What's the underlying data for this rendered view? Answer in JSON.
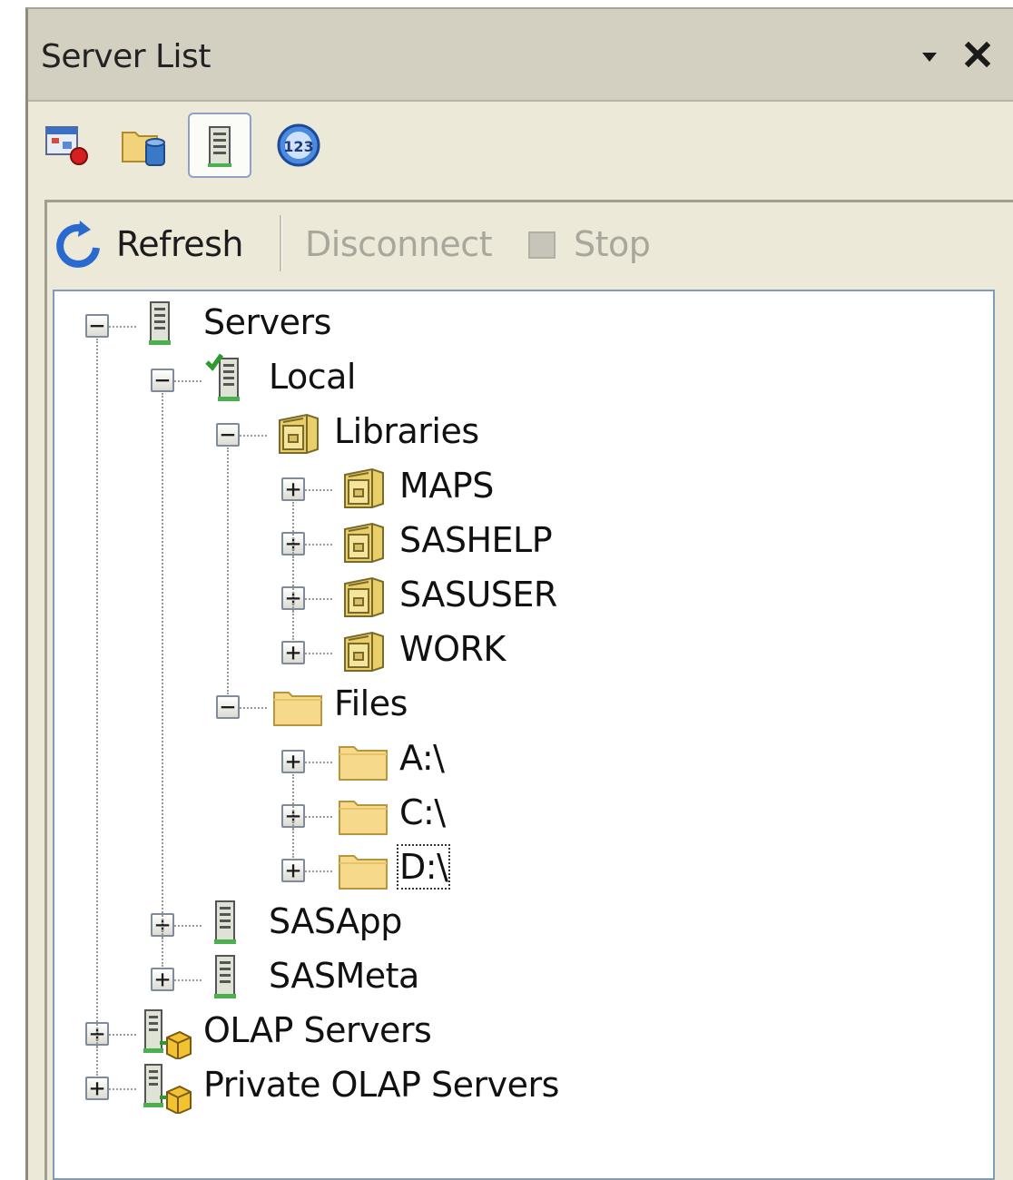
{
  "panel": {
    "title": "Server List",
    "pin_glyph": "▾",
    "close_glyph": "✕"
  },
  "view_toolbar": {
    "buttons": [
      {
        "icon": "process-flow-icon",
        "active": false
      },
      {
        "icon": "data-folder-icon",
        "active": false
      },
      {
        "icon": "server-icon",
        "active": true
      },
      {
        "icon": "task-status-icon",
        "active": false
      }
    ]
  },
  "command_bar": {
    "refresh_label": "Refresh",
    "disconnect_label": "Disconnect",
    "stop_label": "Stop",
    "disconnect_enabled": false,
    "stop_enabled": false
  },
  "tree": {
    "nodes": [
      {
        "label": "Servers",
        "depth": 0,
        "expanded": true,
        "icon": "server-icon"
      },
      {
        "label": "Local",
        "depth": 1,
        "expanded": true,
        "icon": "server-connected-icon"
      },
      {
        "label": "Libraries",
        "depth": 2,
        "expanded": true,
        "icon": "library-cabinet-icon"
      },
      {
        "label": "MAPS",
        "depth": 3,
        "expanded": false,
        "icon": "library-cabinet-icon"
      },
      {
        "label": "SASHELP",
        "depth": 3,
        "expanded": false,
        "icon": "library-cabinet-icon"
      },
      {
        "label": "SASUSER",
        "depth": 3,
        "expanded": false,
        "icon": "library-cabinet-icon"
      },
      {
        "label": "WORK",
        "depth": 3,
        "expanded": false,
        "icon": "library-cabinet-icon"
      },
      {
        "label": "Files",
        "depth": 2,
        "expanded": true,
        "icon": "folder-icon"
      },
      {
        "label": "A:\\",
        "depth": 3,
        "expanded": false,
        "icon": "folder-icon"
      },
      {
        "label": "C:\\",
        "depth": 3,
        "expanded": false,
        "icon": "folder-icon"
      },
      {
        "label": "D:\\",
        "depth": 3,
        "expanded": false,
        "icon": "folder-icon",
        "focused": true
      },
      {
        "label": "SASApp",
        "depth": 1,
        "expanded": false,
        "icon": "server-icon"
      },
      {
        "label": "SASMeta",
        "depth": 1,
        "expanded": false,
        "icon": "server-icon"
      },
      {
        "label": "OLAP Servers",
        "depth": 0,
        "expanded": false,
        "icon": "olap-server-icon"
      },
      {
        "label": "Private OLAP Servers",
        "depth": 0,
        "expanded": false,
        "icon": "olap-server-icon"
      }
    ]
  },
  "colors": {
    "panel_bg": "#ece9d8",
    "title_bg": "#d4d0c1",
    "tree_border": "#7f9db9",
    "disabled_text": "#a9a69b"
  }
}
